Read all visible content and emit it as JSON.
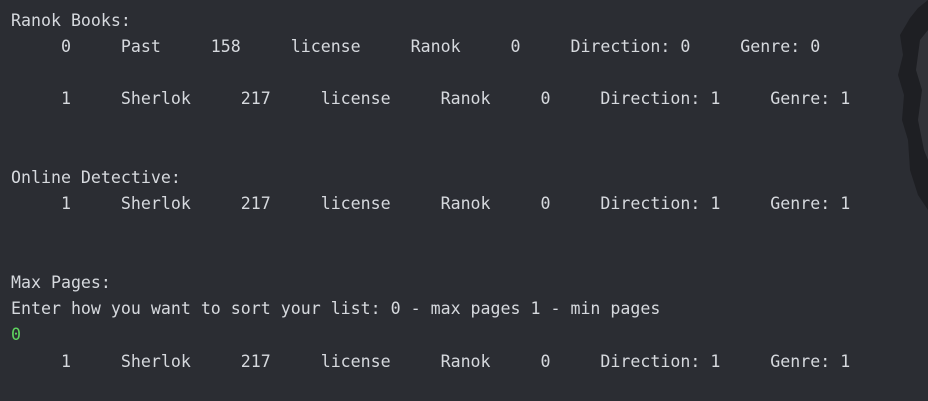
{
  "console": {
    "lines": [
      "Ranok Books:",
      "     0     Past     158     license     Ranok     0     Direction: 0     Genre: 0",
      "     1     Sherlok     217     license     Ranok     0     Direction: 1     Genre: 1",
      "Online Detective:",
      "     1     Sherlok     217     license     Ranok     0     Direction: 1     Genre: 1",
      "Max Pages:",
      "Enter how you want to sort your list: 0 - max pages 1 - min pages",
      "0",
      "     1     Sherlok     217     license     Ranok     0     Direction: 1     Genre: 1"
    ]
  },
  "colors": {
    "background": "#2b2d33",
    "output_text": "#d6d9de",
    "user_input": "#5fd45f"
  }
}
